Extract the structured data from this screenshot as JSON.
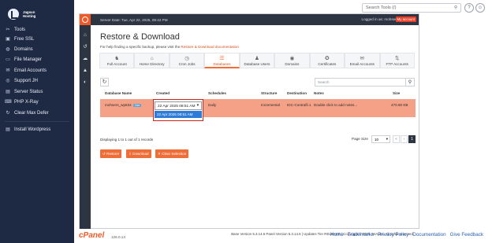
{
  "search": {
    "placeholder": "Search Tools (/)"
  },
  "brand": {
    "line1": "Jagsun",
    "line2": "Hosting"
  },
  "sidebar": {
    "items": [
      {
        "label": "Tools",
        "icon": "wrench-icon",
        "glyph": "✂"
      },
      {
        "label": "Free SSL",
        "icon": "lock-icon",
        "glyph": "▣"
      },
      {
        "label": "Domains",
        "icon": "globe-icon",
        "glyph": "◍"
      },
      {
        "label": "File Manager",
        "icon": "folder-icon",
        "glyph": "▭"
      },
      {
        "label": "Email Accounts",
        "icon": "envelope-icon",
        "glyph": "✉"
      },
      {
        "label": "Support JH",
        "icon": "support-icon",
        "glyph": "◎"
      },
      {
        "label": "Server Status",
        "icon": "server-icon",
        "glyph": "▤"
      },
      {
        "label": "PHP X-Ray",
        "icon": "code-icon",
        "glyph": "⌨"
      },
      {
        "label": "Clear Max Defer",
        "icon": "cycle-icon",
        "glyph": "↻"
      },
      {
        "label": "Install Wordpress",
        "icon": "wordpress-icon",
        "glyph": "▤"
      }
    ]
  },
  "topbar": {
    "server_date": "Server Date: Tue, Apr 22, 2025, 09:42 PM",
    "logged_in": "Logged in as: mohsers",
    "my_account": "My account"
  },
  "page": {
    "title": "Restore & Download",
    "help_text": "For help finding a specific backup, please visit the",
    "help_link": "Restore & Download documentation"
  },
  "tabs": [
    {
      "label": "Full Account",
      "icon": "user-icon",
      "glyph": "♞"
    },
    {
      "label": "Home Directory",
      "icon": "home-icon",
      "glyph": "⌂"
    },
    {
      "label": "Cron Jobs",
      "icon": "clock-icon",
      "glyph": "◷"
    },
    {
      "label": "Databases",
      "icon": "database-icon",
      "glyph": "☰"
    },
    {
      "label": "Database Users",
      "icon": "users-icon",
      "glyph": "♟"
    },
    {
      "label": "Domains",
      "icon": "domain-icon",
      "glyph": "◉"
    },
    {
      "label": "Certificates",
      "icon": "certificate-icon",
      "glyph": "✪"
    },
    {
      "label": "Email Accounts",
      "icon": "mail-icon",
      "glyph": "✉"
    },
    {
      "label": "FTP Accounts",
      "icon": "ftp-icon",
      "glyph": "⇅"
    }
  ],
  "table_search": {
    "placeholder": "Search"
  },
  "columns": [
    "Database Name",
    "Created",
    "Schedules",
    "Structure",
    "Destination",
    "Notes",
    "Size"
  ],
  "row": {
    "database": "mohsers_wp834",
    "badge": "Live",
    "created_selected": "22 Apr 2025 08:51 AM",
    "schedule": "Daily",
    "structure": "Incremental",
    "destination": "IDC-Contrafil.1",
    "notes": "Double click to add notes...",
    "size": "470.80 KB"
  },
  "dropdown_options": [
    "22 Apr 2025 08:51 AM"
  ],
  "records": "Displaying 1 to 1 out of 1 records",
  "pagination": {
    "page_size_label": "Page Size",
    "page_size": "10",
    "current": "1"
  },
  "actions": {
    "restore": "Restore",
    "download": "Download",
    "clear": "Clear Selection"
  },
  "footer_version": "Base Version 5.3.14.6 Panel Version 5.3.14.6 | Updates Tier RELEASE | Copyright © 2025 JetApps. All rights reserved.",
  "bottom": {
    "logo": "cPanel",
    "version": "126.0.14",
    "links": [
      "Home",
      "Trademarks",
      "Privacy Policy",
      "Documentation",
      "Give Feedback"
    ]
  },
  "colors": {
    "accent": "#ef6d37",
    "selected_row": "#f4a187",
    "sidebar": "#1e2a44",
    "highlight_box": "#d2201b"
  }
}
